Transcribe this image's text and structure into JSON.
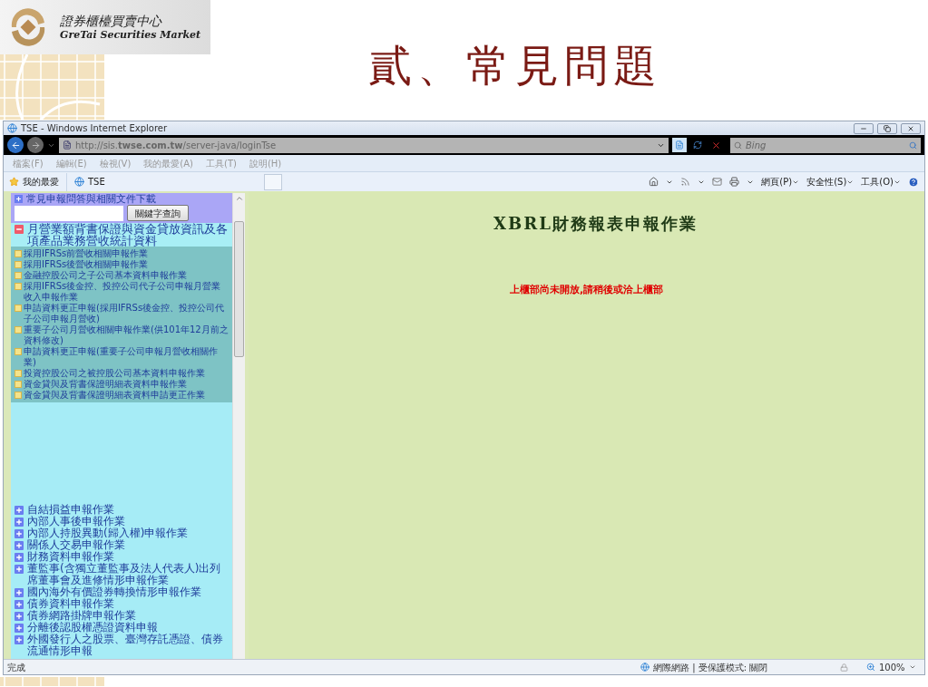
{
  "slide": {
    "logo": {
      "name_zh": "證券櫃檯買賣中心",
      "name_en": "GreTai Securities Market"
    },
    "title": "貳、常見問題"
  },
  "browser": {
    "window_title": "TSE - Windows Internet Explorer",
    "url": "http://sis.**twse.com.tw**/server-java/loginTse",
    "search_placeholder": "Bing",
    "menu": [
      "檔案(F)",
      "編輯(E)",
      "檢視(V)",
      "我的最愛(A)",
      "工具(T)",
      "說明(H)"
    ],
    "favorites": "我的最愛",
    "tab": "TSE",
    "commands": [
      "網頁(P)",
      "安全性(S)",
      "工具(O)"
    ],
    "sidebar": {
      "top_item": "常見申報問答與相關文件下載",
      "search_button": "關鍵字查詢",
      "groups": [
        {
          "label": "月營業額背書保證與資金貸放資訊及各項產品業務營收統計資料",
          "expanded": true,
          "children": [
            "採用IFRSs前營收相關申報作業",
            "採用IFRSs後營收相關申報作業",
            "金融控股公司之子公司基本資料申報作業",
            "採用IFRSs後金控、投控公司代子公司申報月營業收入申報作業",
            "申請資料更正申報(採用IFRSs後金控、投控公司代子公司申報月營收)",
            "重要子公司月營收相關申報作業(供101年12月前之資料修改)",
            "申請資料更正申報(重要子公司申報月營收相關作業)",
            "投資控股公司之被控股公司基本資料申報作業",
            "資金貸與及背書保證明細表資料申報作業",
            "資金貸與及背書保證明細表資料申請更正作業"
          ]
        },
        {
          "label": "自結損益申報作業",
          "expanded": false
        },
        {
          "label": "內部人事後申報作業",
          "expanded": false
        },
        {
          "label": "內部人持股異動(歸入權)申報作業",
          "expanded": false
        },
        {
          "label": "關係人交易申報作業",
          "expanded": false
        },
        {
          "label": "財務資料申報作業",
          "expanded": false
        },
        {
          "label": "董監事(含獨立董監事及法人代表人)出列席董事會及進修情形申報作業",
          "expanded": false
        },
        {
          "label": "國內海外有價證券轉換情形申報作業",
          "expanded": false
        },
        {
          "label": "債券資料申報作業",
          "expanded": false
        },
        {
          "label": "債券網路掛牌申報作業",
          "expanded": false
        },
        {
          "label": "分離後認股權憑證資料申報",
          "expanded": false
        },
        {
          "label": "外國發行人之股票、臺灣存託憑證、債券流通情形申報",
          "expanded": false
        }
      ]
    },
    "main": {
      "heading": "XBRL財務報表申報作業",
      "message": "上櫃部尚未開放,請稍後或洽上櫃部"
    },
    "status": {
      "text": "完成",
      "zone": "網際網路 | 受保護模式: 關閉",
      "zoom": "100%"
    }
  }
}
